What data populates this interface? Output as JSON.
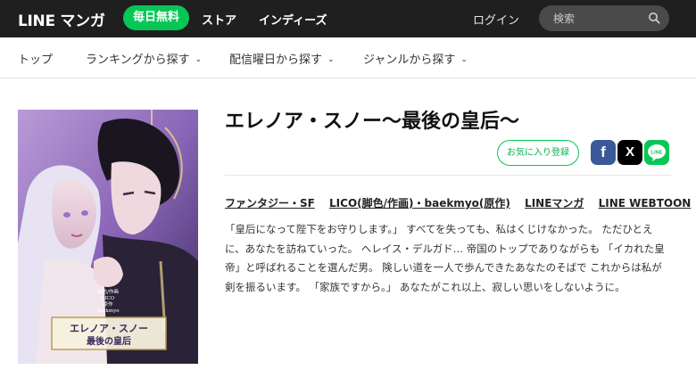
{
  "header": {
    "logo": "LINE マンガ",
    "nav_pill": "毎日無料",
    "nav_store": "ストア",
    "nav_indies": "インディーズ",
    "login": "ログイン",
    "search_placeholder": "検索",
    "accent": "#06c755"
  },
  "subnav": {
    "top": "トップ",
    "ranking": "ランキングから探す",
    "weekday": "配信曜日から探す",
    "genre": "ジャンルから探す"
  },
  "book": {
    "title": "エレノア・スノー〜最後の皇后〜",
    "favorite_label": "お気に入り登録",
    "share_fb": "f",
    "share_x": "X",
    "share_line": "LINE",
    "tags": [
      "ファンタジー・SF",
      "LICO(脚色/作画)・baekmyo(原作)",
      "LINEマンガ",
      "LINE WEBTOON"
    ],
    "description": "「皇后になって陛下をお守りします。」 すべてを失っても、私はくじけなかった。 ただひとえに、あなたを訪ねていった。 ヘレイス・デルガド… 帝国のトップでありながらも 「イカれた皇帝」と呼ばれることを選んだ男。 険しい道を一人で歩んできたあなたのそばで これからは私が剣を振るいます。 「家族ですから。」 あなたがこれ以上、寂しい思いをしないように。",
    "cover_credit_1": "脚色/作画",
    "cover_credit_2": "LICO",
    "cover_credit_3": "原作",
    "cover_credit_4": "baekmyo",
    "cover_title_1": "エレノア・スノー",
    "cover_title_2": "最後の皇后"
  }
}
